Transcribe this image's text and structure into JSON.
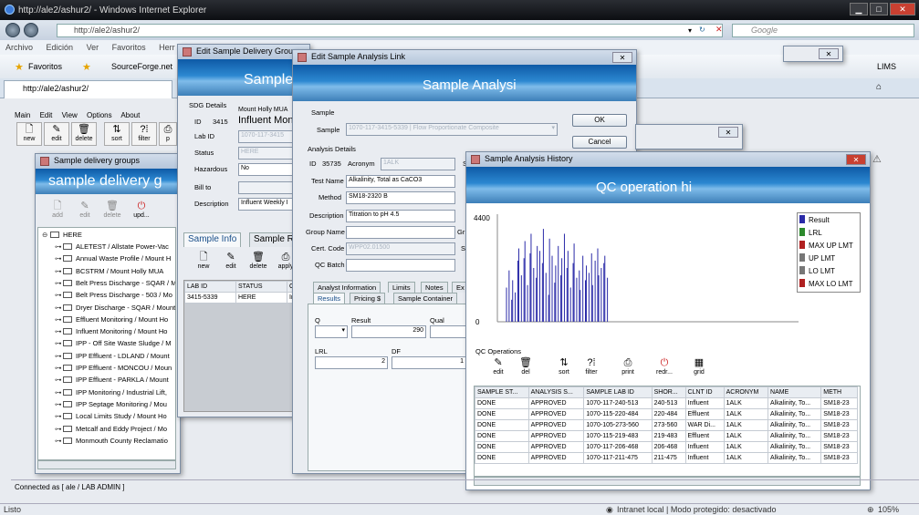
{
  "browser": {
    "window_title": "http://ale2/ashur2/ - Windows Internet Explorer",
    "address": "http://ale2/ashur2/",
    "search_placeholder": "Google",
    "menu": [
      "Archivo",
      "Edición",
      "Ver",
      "Favoritos",
      "Herr"
    ],
    "favorites_label": "Favoritos",
    "favorite_link": "SourceForge.net",
    "lims_link": "LIMS",
    "tab_title": "http://ale2/ashur2/",
    "status_left": "Listo",
    "status_zone": "Intranet local | Modo protegido: desactivado",
    "zoom": "105%"
  },
  "lims": {
    "menu": [
      "Main",
      "Edit",
      "View",
      "Options",
      "About"
    ],
    "toolbar": [
      "new",
      "edit",
      "delete",
      "sort",
      "filter",
      "p"
    ],
    "connected": "Connected as [ ale / LAB ADMIN ]"
  },
  "sdg_window": {
    "title": "Sample delivery groups",
    "banner": "sample delivery g",
    "toolbar": [
      "add",
      "edit",
      "delete",
      "upd..."
    ],
    "root": "HERE",
    "items": [
      "ALETEST / Allstate Power-Vac",
      "Annual Waste Profile / Mount H",
      "BCSTRM / Mount Holly MUA",
      "Belt Press Discharge - SQAR / M",
      "Belt Press Discharge - 503 / Mo",
      "Dryer Discharge - SQAR / Mount",
      "Effluent Monitoring / Mount Ho",
      "Influent Monitoring / Mount Ho",
      "IPP - Off Site Waste Sludge / M",
      "IPP Effluent - LDLAND / Mount",
      "IPP Effluent - MONCOU / Moun",
      "IPP Effluent - PARKLA / Mount",
      "IPP Monitoring / Industrial Lift,",
      "IPP Septage Monitoring / Mou",
      "Local Limits Study / Mount Ho",
      "Metcalf and Eddy Project / Mo",
      "Monmouth County Reclamatio"
    ]
  },
  "edit_sdg": {
    "title": "Edit Sample Delivery Group",
    "banner": "Sample",
    "section": "SDG Details",
    "id_label": "ID",
    "id_value": "3415",
    "client": "Mount Holly MUA",
    "name": "Influent Moni",
    "lab_id_label": "Lab ID",
    "lab_id_value": "1070-117-3415",
    "status_label": "Status",
    "status_value": "HERE",
    "hazardous_label": "Hazardous",
    "hazardous_value": "No",
    "bill_to_label": "Bill to",
    "description_label": "Description",
    "description_value": "Influent Weekly I",
    "tabs": [
      "Sample Info",
      "Sample R"
    ],
    "toolbar": [
      "new",
      "edit",
      "delete",
      "apply"
    ],
    "columns": [
      "LAB ID",
      "STATUS",
      "C"
    ],
    "row": [
      "3415-5339",
      "HERE",
      "In"
    ]
  },
  "edit_link": {
    "title": "Edit Sample Analysis Link",
    "banner": "Sample Analysi",
    "sample_section": "Sample",
    "sample_label": "Sample",
    "sample_value": "1070-117-3415-5339 | Flow Proportionate Composite",
    "ok": "OK",
    "cancel": "Cancel",
    "analysis_section": "Analysis Details",
    "id_label": "ID",
    "id_value": "35735",
    "acronym_label": "Acronym",
    "acronym_value": "1ALK",
    "test_name_label": "Test Name",
    "test_name_value": "Alkalinity, Total as CaCO3",
    "method_label": "Method",
    "method_value": "SM18-2320 B",
    "description_label": "Description",
    "description_value": "Titration to pH 4.5",
    "group_label": "Group Name",
    "cert_label": "Cert. Code",
    "cert_value": "WPP02.01500",
    "qc_label": "QC Batch",
    "side_letters": [
      "S",
      "Gr",
      "Si"
    ],
    "tabs_top": [
      "Analyst Information",
      "Limits",
      "Notes",
      "Ex"
    ],
    "tabs_bottom": [
      "Results",
      "Pricing $",
      "Sample Container"
    ],
    "q_label": "Q",
    "result_label": "Result",
    "result_value": "290",
    "qual_label": "Qual",
    "lrl_label": "LRL",
    "lrl_value": "2",
    "df_label": "DF",
    "df_value": "1"
  },
  "history": {
    "title": "Sample Analysis History",
    "banner": "QC operation hi",
    "qc_section": "QC Operations",
    "toolbar": [
      "edit",
      "del",
      "sort",
      "filter",
      "print",
      "redr...",
      "grid"
    ],
    "columns": [
      "SAMPLE ST...",
      "ANALYSIS S...",
      "SAMPLE LAB ID",
      "SHOR...",
      "CLNT ID",
      "ACRONYM",
      "NAME",
      "METH"
    ],
    "rows": [
      [
        "DONE",
        "APPROVED",
        "1070-117-240-513",
        "240-513",
        "Influent",
        "1ALK",
        "Alkalinity, To...",
        "SM18-23"
      ],
      [
        "DONE",
        "APPROVED",
        "1070-115-220-484",
        "220-484",
        "Effluent",
        "1ALK",
        "Alkalinity, To...",
        "SM18-23"
      ],
      [
        "DONE",
        "APPROVED",
        "1070-105-273-560",
        "273-560",
        "WAR Di...",
        "1ALK",
        "Alkalinity, To...",
        "SM18-23"
      ],
      [
        "DONE",
        "APPROVED",
        "1070-115-219-483",
        "219-483",
        "Effluent",
        "1ALK",
        "Alkalinity, To...",
        "SM18-23"
      ],
      [
        "DONE",
        "APPROVED",
        "1070-117-206-468",
        "206-468",
        "Influent",
        "1ALK",
        "Alkalinity, To...",
        "SM18-23"
      ],
      [
        "DONE",
        "APPROVED",
        "1070-117-211-475",
        "211-475",
        "Influent",
        "1ALK",
        "Alkalinity, To...",
        "SM18-23"
      ]
    ]
  },
  "chart_data": {
    "type": "bar",
    "ylim": [
      0,
      4400
    ],
    "y_ticks": [
      "4400",
      "0"
    ],
    "legend": [
      {
        "label": "Result",
        "color": "#2a2aa8"
      },
      {
        "label": "LRL",
        "color": "#2c8a2c"
      },
      {
        "label": "MAX UP LMT",
        "color": "#b02020"
      },
      {
        "label": "UP LMT",
        "color": "#777777"
      },
      {
        "label": "LO LMT",
        "color": "#777777"
      },
      {
        "label": "MAX LO LMT",
        "color": "#b02020"
      }
    ],
    "series": [
      {
        "values": [
          1400,
          2100,
          900,
          1700,
          1200,
          2500,
          3000,
          1900,
          2600,
          3300,
          1500,
          2800,
          3600,
          2200,
          1800,
          3100,
          2900,
          2400,
          3800,
          2000,
          1100,
          3400,
          2700,
          1600,
          2300,
          3100,
          1900,
          2600,
          3600,
          2200,
          2900,
          1400,
          2400,
          3200,
          1800,
          2100,
          1300,
          2700,
          1700,
          2300,
          2000,
          2800,
          1500,
          2500,
          3000,
          1900,
          2200,
          2400,
          2700,
          1800
        ]
      }
    ]
  }
}
